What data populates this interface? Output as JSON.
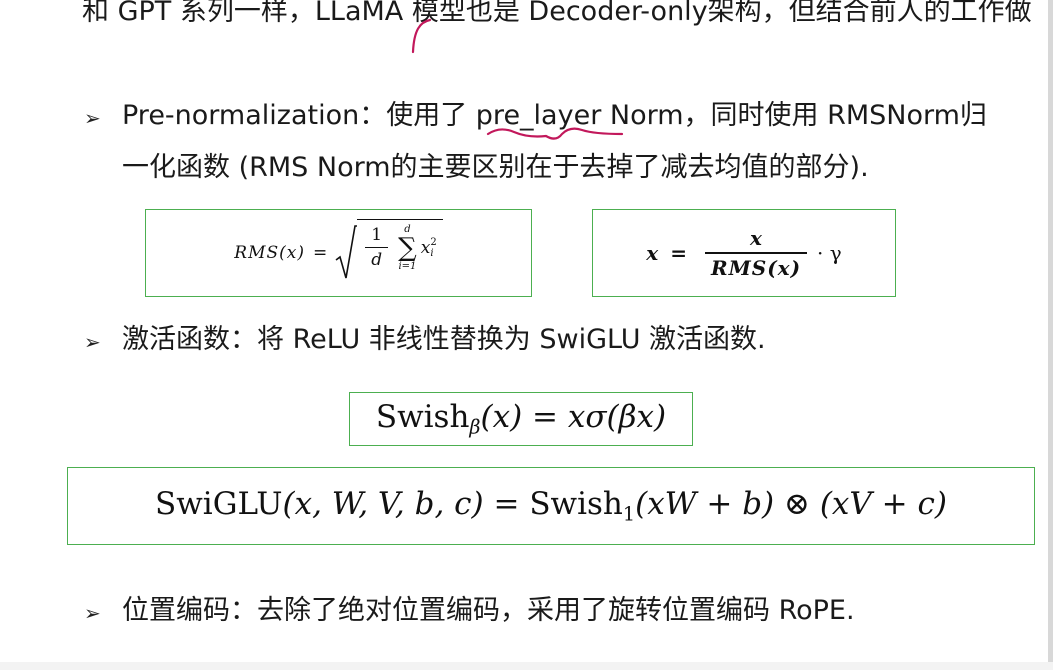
{
  "intro": {
    "text": "和 GPT 系列一样，LLaMA 模型也是 Decoder-only架构，但结合前人的工作做"
  },
  "bullets": {
    "marker": "➢",
    "prenorm_line1": "Pre-normalization：使用了 pre_layer Norm，同时使用 RMSNorm归",
    "prenorm_line2": "一化函数 (RMS Norm的主要区别在于去掉了减去均值的部分).",
    "activation": "激活函数：将 ReLU 非线性替换为 SwiGLU 激活函数.",
    "position": "位置编码：去除了绝对位置编码，采用了旋转位置编码 RoPE."
  },
  "formulas": {
    "rms_lhs": "RMS(x)",
    "rms_eq": "=",
    "rms_frac_num": "1",
    "rms_frac_den": "d",
    "rms_sum": "∑",
    "rms_sum_upper": "d",
    "rms_sum_lower": "i=1",
    "rms_term": "x",
    "rms_term_sup": "2",
    "rms_term_sub": "i",
    "norm_lhs": "x",
    "norm_eq": "=",
    "norm_num": "x",
    "norm_den": "RMS(x)",
    "norm_tail": "· γ",
    "swish_name": "Swish",
    "swish_sub": "β",
    "swish_rest": "(x) = xσ(βx)",
    "swiglu_name": "SwiGLU",
    "swiglu_args": "(x, W, V, b, c) = ",
    "swiglu_swish": "Swish",
    "swiglu_swish_sub": "1",
    "swiglu_rest": "(xW + b) ⊗ (xV + c)"
  },
  "colors": {
    "box_border": "#4caf50",
    "annotation": "#c2185b"
  }
}
